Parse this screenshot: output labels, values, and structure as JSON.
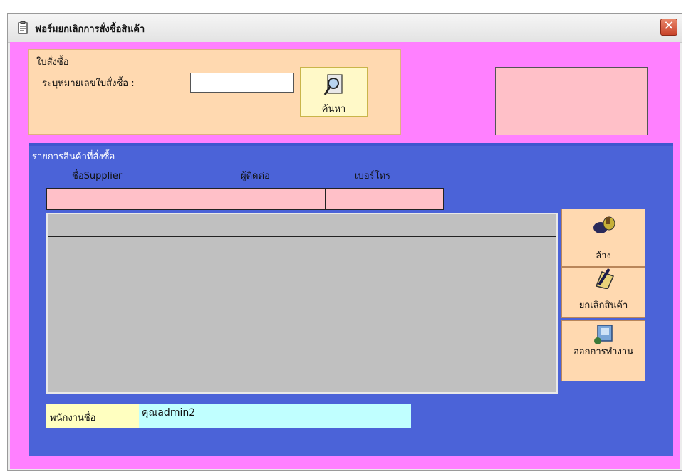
{
  "window": {
    "title": "ฟอร์มยกเลิกการสั่งซื้อสินค้า",
    "close_glyph": "✕"
  },
  "po_group": {
    "legend": "ใบสั่งซื้อ",
    "po_number_label": "ระบุหมายเลขใบสั่งซื้อ :",
    "po_number_value": "",
    "search_button_label": "ค้นหา"
  },
  "items_group": {
    "legend": "รายการสินค้าที่สั่งซื้อ",
    "columns": {
      "supplier": "ชื่อSupplier",
      "contact": "ผู้ติดต่อ",
      "phone": "เบอร์โทร"
    },
    "buttons": {
      "clear": "ล้าง",
      "cancel_item": "ยกเลิกสินค้า",
      "exit": "ออกการทำงาน"
    },
    "employee_label": "พนักงานชื่อ",
    "employee_value": "คุณadmin2"
  },
  "icons": {
    "title": "form-icon",
    "search": "magnifier-icon",
    "clear": "broom-icon",
    "cancel_item": "pencil-book-icon",
    "exit": "computer-exit-icon",
    "close": "close-icon"
  },
  "colors": {
    "form_bg": "#ff80ff",
    "po_group_bg": "#ffd9b0",
    "items_group_bg": "#4b63d8",
    "header_cell_bg": "#ffc0c8",
    "grid_bg": "#c0c0c0",
    "employee_label_bg": "#ffffc0",
    "employee_value_bg": "#c0ffff"
  }
}
